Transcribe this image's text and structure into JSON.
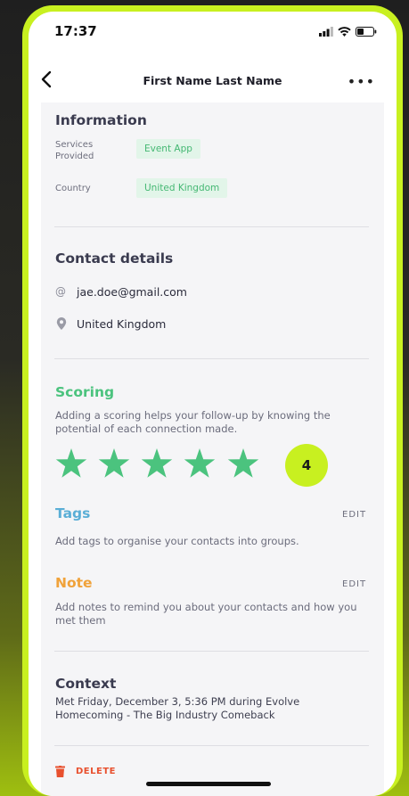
{
  "status_bar": {
    "time": "17:37"
  },
  "nav": {
    "title": "First Name Last Name",
    "back_icon": "chevron-left-icon",
    "more_label": "•••"
  },
  "information": {
    "heading": "Information",
    "services_label": "Services Provided",
    "services_value": "Event App",
    "country_label": "Country",
    "country_value": "United Kingdom"
  },
  "contact": {
    "heading": "Contact details",
    "email_icon": "@",
    "email": "jae.doe@gmail.com",
    "location": "United Kingdom"
  },
  "scoring": {
    "heading": "Scoring",
    "description": "Adding a scoring helps your follow-up by knowing the potential of each connection made.",
    "stars_total": 5,
    "stars_filled": 5,
    "score": "4",
    "star_color": "#4bc37e",
    "badge_color": "#c8f020"
  },
  "tags": {
    "heading": "Tags",
    "edit_label": "EDIT",
    "description": "Add tags to organise your contacts into groups.",
    "color": "#5aaed6"
  },
  "note": {
    "heading": "Note",
    "edit_label": "EDIT",
    "description": "Add notes to remind you about your contacts and how you met them",
    "color": "#f0a23a"
  },
  "context": {
    "heading": "Context",
    "description": "Met Friday, December 3, 5:36 PM during Evolve Homecoming - The Big Industry Comeback"
  },
  "delete": {
    "label": "DELETE",
    "color": "#e8502e"
  }
}
